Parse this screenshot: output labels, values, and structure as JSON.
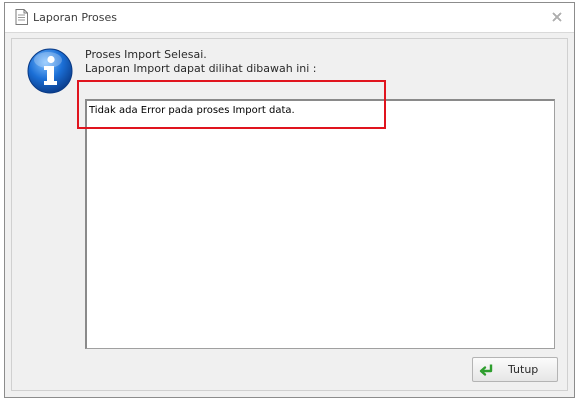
{
  "window": {
    "title": "Laporan Proses",
    "title_icon": "document-icon",
    "close_icon": "close-icon"
  },
  "message": {
    "icon": "info-icon",
    "line1": "Proses Import Selesai.",
    "line2": "Laporan Import dapat dilihat dibawah ini :"
  },
  "report": {
    "text": "Tidak ada Error pada proses Import data."
  },
  "buttons": {
    "close_label": "Tutup",
    "close_icon": "return-arrow-icon"
  },
  "colors": {
    "highlight": "#e0141e",
    "info_icon_blue": "#1b6fd6",
    "return_icon_green": "#2e9e2e"
  }
}
